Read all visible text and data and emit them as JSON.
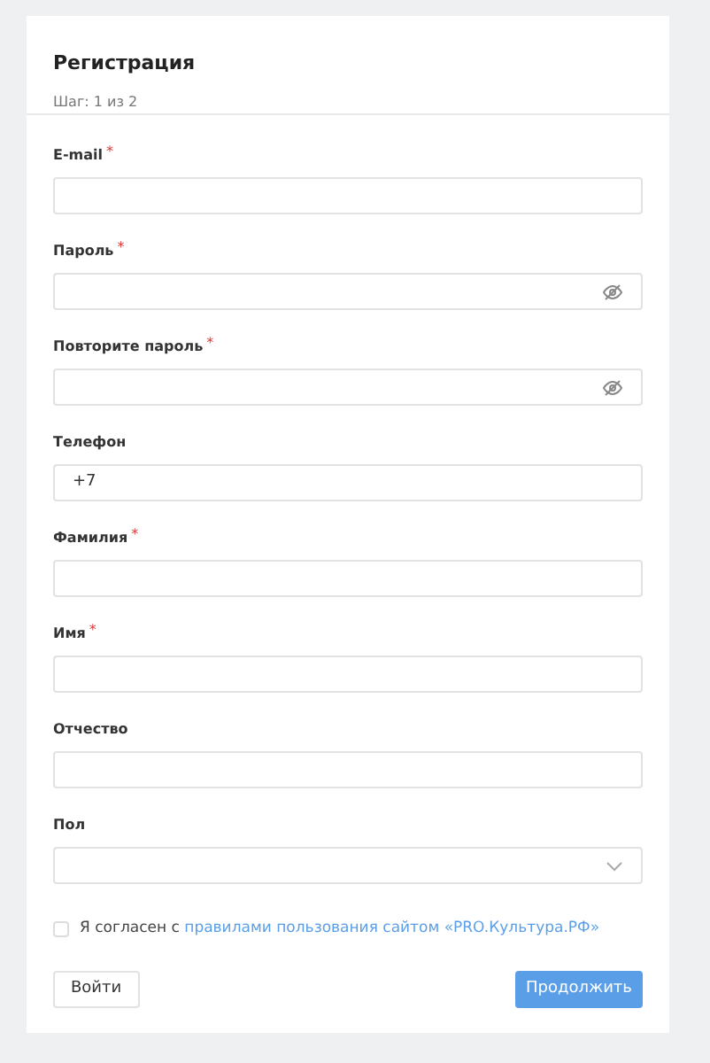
{
  "title": "Регистрация",
  "step": "Шаг: 1 из 2",
  "fields": [
    {
      "kind": "text",
      "label": "E-mail",
      "required": true
    },
    {
      "kind": "password",
      "label": "Пароль",
      "required": true
    },
    {
      "kind": "password",
      "label": "Повторите пароль",
      "required": true
    },
    {
      "kind": "text",
      "label": "Телефон",
      "required": false,
      "value": "+7"
    },
    {
      "kind": "text",
      "label": "Фамилия",
      "required": true
    },
    {
      "kind": "text",
      "label": "Имя",
      "required": true
    },
    {
      "kind": "text",
      "label": "Отчество",
      "required": false
    },
    {
      "kind": "select",
      "label": "Пол",
      "required": false
    }
  ],
  "agreement": {
    "checked": false,
    "text": "Я согласен с",
    "link": "правилами пользования сайтом «PRO.Культура.РФ»"
  },
  "buttons": {
    "login": "Войти",
    "continue": "Продолжить"
  },
  "required_mark": "*"
}
